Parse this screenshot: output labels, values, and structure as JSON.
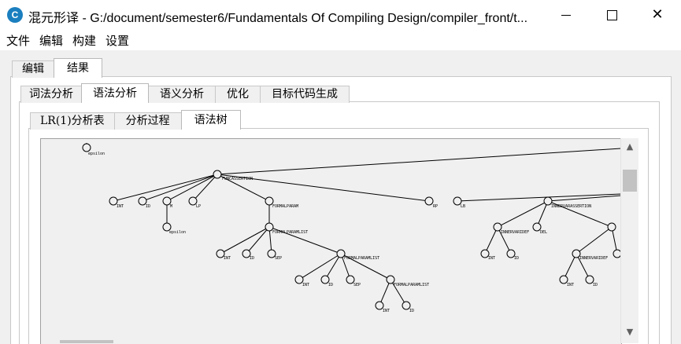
{
  "window": {
    "title": "混元形译 - G:/document/semester6/Fundamentals Of Compiling Design/compiler_front/t...",
    "icon_glyph": "C"
  },
  "menu": [
    "文件",
    "编辑",
    "构建",
    "设置"
  ],
  "top_tabs": [
    {
      "label": "编辑",
      "active": false
    },
    {
      "label": "结果",
      "active": true
    }
  ],
  "result_tabs": [
    {
      "label": "词法分析",
      "active": false
    },
    {
      "label": "语法分析",
      "active": true
    },
    {
      "label": "语义分析",
      "active": false
    },
    {
      "label": "优化",
      "active": false
    },
    {
      "label": "目标代码生成",
      "active": false
    }
  ],
  "syntax_tabs": [
    {
      "label": "LR(1)分析表",
      "active": false
    },
    {
      "label": "分析过程",
      "active": false
    },
    {
      "label": "语法树",
      "active": true
    }
  ],
  "tree_labels": {
    "epsilon": "epsilon",
    "func_assertion": "FUNCASSERTION",
    "int": "INT",
    "id": "ID",
    "m": "M",
    "lp": "LP",
    "rp": "RP",
    "lb": "LB",
    "formal_param": "FORMALPARAM",
    "formal_param_list": "FORMALPARAMLIST",
    "sep": "SEP",
    "inner_var_assertion": "INNERVARASSERTION",
    "inner_var_def": "INNERVARIDEF",
    "del": "DEL"
  },
  "colors": {
    "canvas_bg": "#f0f0f0",
    "node_stroke": "#000000",
    "app_icon": "#1b7fbf"
  }
}
